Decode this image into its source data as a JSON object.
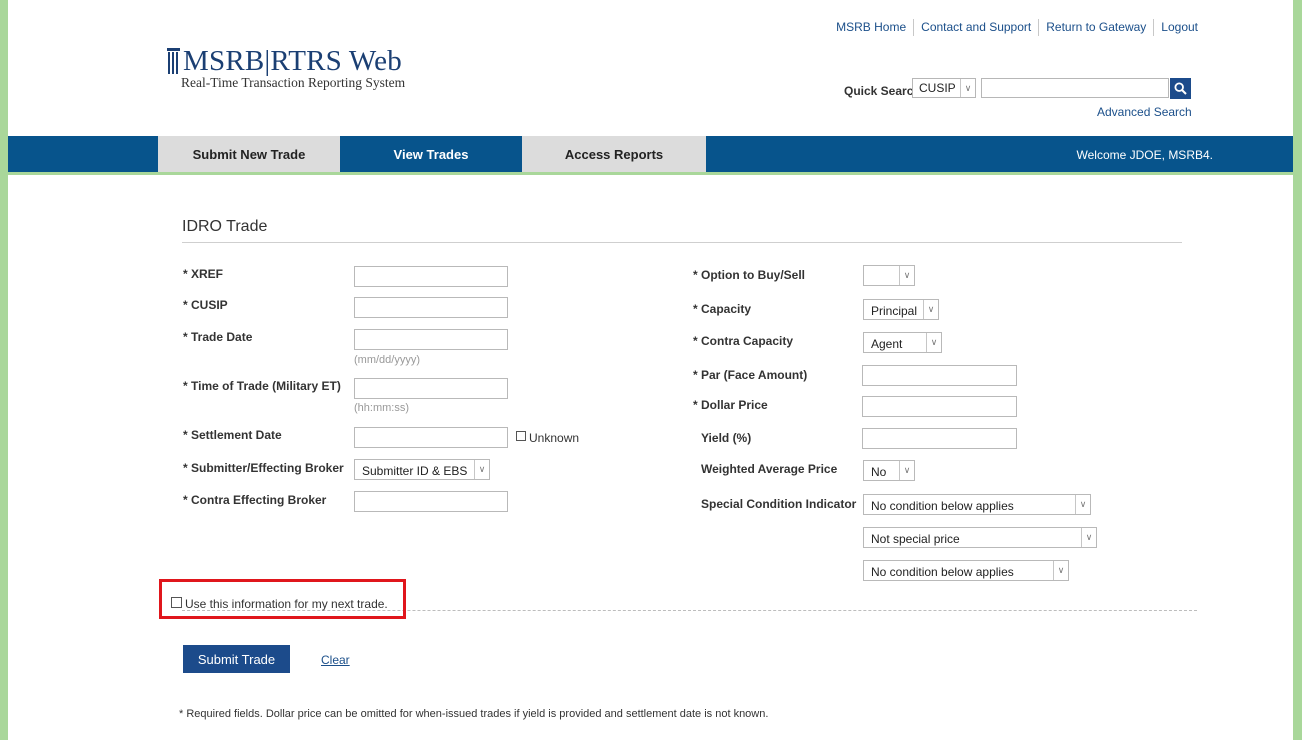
{
  "top_links": [
    "MSRB Home",
    "Contact and Support",
    "Return to Gateway",
    "Logout"
  ],
  "logo": {
    "title": "MSRB|RTRS Web",
    "subtitle": "Real-Time Transaction Reporting System"
  },
  "quick_search": {
    "label": "Quick Search",
    "type_value": "CUSIP",
    "query_value": "",
    "advanced_link": "Advanced Search"
  },
  "nav": {
    "tabs": [
      "Submit New Trade",
      "View Trades",
      "Access Reports"
    ],
    "welcome": "Welcome JDOE, MSRB4."
  },
  "form": {
    "title": "IDRO Trade",
    "left": {
      "xref": "* XREF",
      "cusip": "* CUSIP",
      "trade_date": "* Trade Date",
      "trade_date_hint": "(mm/dd/yyyy)",
      "time_of_trade": "* Time of Trade (Military ET)",
      "time_hint": "(hh:mm:ss)",
      "settlement_date": "* Settlement Date",
      "unknown": "Unknown",
      "submitter": "* Submitter/Effecting Broker",
      "submitter_value": "Submitter ID & EBS",
      "contra_broker": "* Contra Effecting Broker"
    },
    "right": {
      "option": "* Option to Buy/Sell",
      "option_value": "",
      "capacity": "* Capacity",
      "capacity_value": "Principal",
      "contra_capacity": "* Contra Capacity",
      "contra_capacity_value": "Agent",
      "par": "* Par (Face Amount)",
      "dollar_price": "* Dollar Price",
      "yield": "Yield (%)",
      "weighted": "Weighted Average Price",
      "weighted_value": "No",
      "special": "Special Condition Indicator",
      "special_value_1": "No condition below applies",
      "special_value_2": "Not special price",
      "special_value_3": "No condition below applies"
    },
    "reuse_checkbox": "Use this information for my next trade.",
    "submit": "Submit Trade",
    "clear": "Clear",
    "footnote": "* Required fields. Dollar price can be omitted for when-issued trades if yield is provided and settlement date is not known."
  },
  "colors": {
    "nav_blue": "#07548c",
    "button_blue": "#1c4b8b",
    "highlight_red": "#e0161c",
    "frame_green": "#a9d79a"
  }
}
